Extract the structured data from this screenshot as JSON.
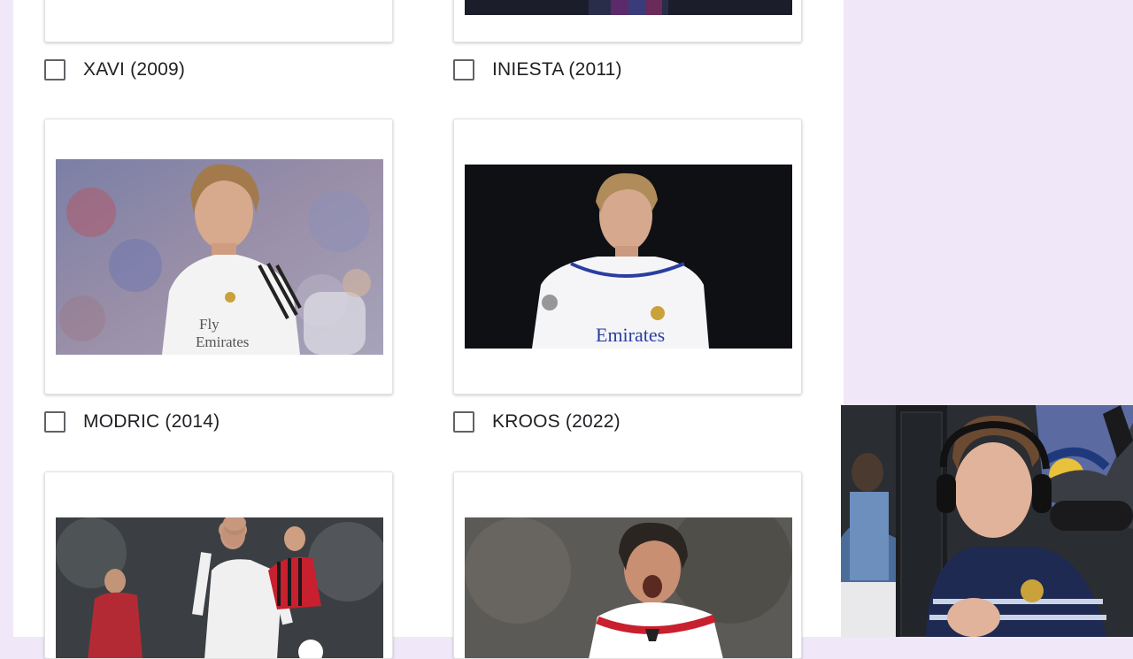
{
  "options": [
    {
      "label": "XAVI (2009)",
      "checked": false
    },
    {
      "label": "INIESTA (2011)",
      "checked": false
    },
    {
      "label": "MODRIC (2014)",
      "checked": false
    },
    {
      "label": "KROOS (2022)",
      "checked": false
    }
  ],
  "jersey_text": {
    "modric": "Fly\nEmirates",
    "kroos": "Emirates"
  },
  "colors": {
    "page_background": "#f0e8f8",
    "panel_background": "#ffffff",
    "checkbox_border": "#5f6368",
    "label_text": "#202124"
  }
}
